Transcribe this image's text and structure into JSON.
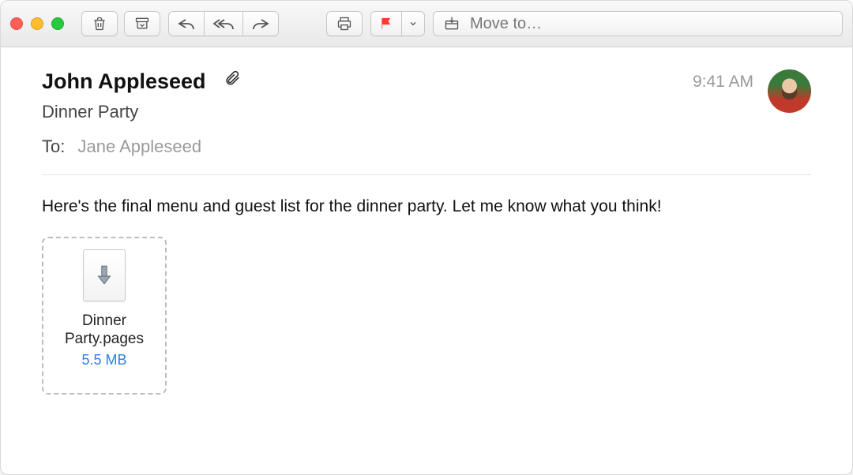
{
  "toolbar": {
    "move_label": "Move to…"
  },
  "email": {
    "sender": "John Appleseed",
    "subject": "Dinner Party",
    "to_label": "To:",
    "recipients": "Jane Appleseed",
    "timestamp": "9:41 AM",
    "body": "Here's the final menu and guest list for the dinner party. Let me know what you think!"
  },
  "attachment": {
    "name": "Dinner Party.pages",
    "size": "5.5 MB"
  }
}
